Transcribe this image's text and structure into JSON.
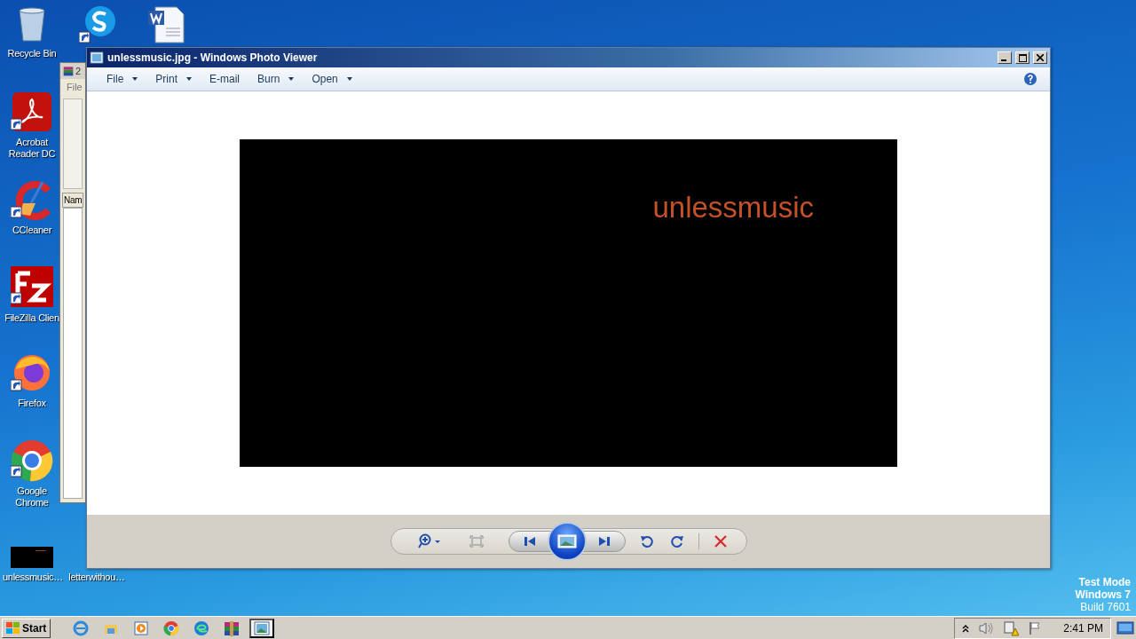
{
  "desktop_icons": [
    {
      "label": "Recycle Bin",
      "kind": "bin"
    },
    {
      "kind": "skype"
    },
    {
      "kind": "word"
    },
    {
      "label": "Acrobat Reader DC",
      "kind": "acrobat"
    },
    {
      "label": "CCleaner",
      "kind": "ccleaner"
    },
    {
      "label": "FileZilla Clien",
      "kind": "filezilla"
    },
    {
      "label": "Firefox",
      "kind": "firefox"
    },
    {
      "label": "Google Chrome",
      "kind": "chrome"
    },
    {
      "label": "unlessmusic…",
      "kind": "thumb"
    },
    {
      "label": "letterwithou…",
      "kind": "doc"
    }
  ],
  "background_window": {
    "title": "2",
    "menu": "File",
    "column": "Nam"
  },
  "viewer": {
    "title": "unlessmusic.jpg - Windows Photo Viewer",
    "menu": [
      {
        "label": "File",
        "dropdown": true
      },
      {
        "label": "Print",
        "dropdown": true
      },
      {
        "label": "E-mail",
        "dropdown": false
      },
      {
        "label": "Burn",
        "dropdown": true
      },
      {
        "label": "Open",
        "dropdown": true
      }
    ],
    "image_text": "unlessmusic"
  },
  "system_watermark": [
    "Test Mode",
    "Windows 7",
    "Build 7601"
  ],
  "taskbar": {
    "start": "Start",
    "apps": [
      {
        "kind": "ie",
        "selected": false
      },
      {
        "kind": "explorer",
        "selected": false
      },
      {
        "kind": "media",
        "selected": false
      },
      {
        "kind": "chrome",
        "selected": false
      },
      {
        "kind": "edge",
        "selected": false
      },
      {
        "kind": "winrar",
        "selected": false
      },
      {
        "kind": "photo",
        "selected": true
      }
    ],
    "clock": "2:41 PM"
  }
}
